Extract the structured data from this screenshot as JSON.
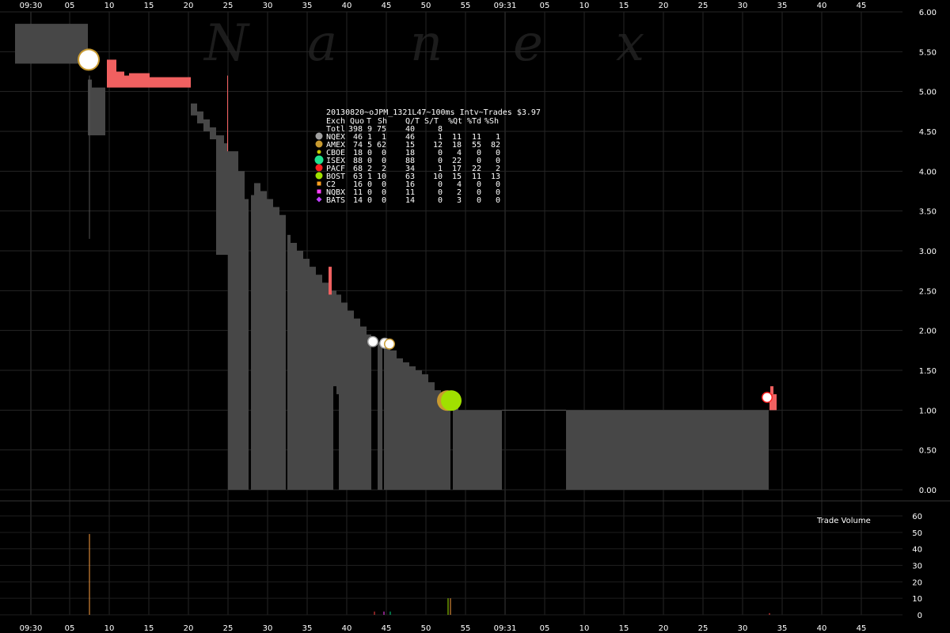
{
  "chart_data": {
    "type": "line",
    "title": "20130820~oJPM_1321L47~100ms Intv~Trades $3.97",
    "watermark": [
      "N",
      "a",
      "n",
      "e",
      "x"
    ],
    "x_axis": {
      "start_label": "09:30",
      "mid_label": "09:31",
      "tick_labels": [
        "09:30",
        "05",
        "10",
        "15",
        "20",
        "25",
        "30",
        "35",
        "40",
        "45",
        "50",
        "55",
        "09:31",
        "05",
        "10",
        "15",
        "20",
        "25",
        "30",
        "35",
        "40",
        "45"
      ],
      "unit": "seconds after 09:30:00",
      "range": [
        -3.5,
        115
      ]
    },
    "price_axis": {
      "tick_labels": [
        "6.00",
        "5.50",
        "5.00",
        "4.50",
        "4.00",
        "3.50",
        "3.00",
        "2.50",
        "2.00",
        "1.50",
        "1.00",
        "0.50",
        "0.00"
      ],
      "range": [
        0,
        6
      ]
    },
    "volume_panel": {
      "label": "Trade Volume",
      "tick_labels": [
        "60",
        "50",
        "40",
        "30",
        "20",
        "10",
        "0"
      ],
      "range": [
        0,
        60
      ],
      "bars": [
        {
          "t": 7.4,
          "v": 49,
          "color": "#ffa040"
        },
        {
          "t": 43.4,
          "v": 2,
          "color": "#ff4040"
        },
        {
          "t": 44.6,
          "v": 2,
          "color": "#ff40ff"
        },
        {
          "t": 45.4,
          "v": 2,
          "color": "#00d080"
        },
        {
          "t": 52.7,
          "v": 10,
          "color": "#a0e000"
        },
        {
          "t": 53.0,
          "v": 10,
          "color": "#ffa040"
        },
        {
          "t": 93.3,
          "v": 1,
          "color": "#ff4040"
        }
      ]
    },
    "nbbo_segments": [
      {
        "t0": -2,
        "t1": 7.2,
        "bid": 5.35,
        "ask": 5.85
      },
      {
        "t0": 7.2,
        "t1": 7.7,
        "bid": 4.45,
        "ask": 5.15
      },
      {
        "t0": 7.7,
        "t1": 8.5,
        "bid": 4.45,
        "ask": 5.05
      },
      {
        "t0": 8.5,
        "t1": 9.4,
        "bid": 4.45,
        "ask": 5.05
      },
      {
        "t0": 20.2,
        "t1": 21,
        "bid": 4.7,
        "ask": 4.85
      },
      {
        "t0": 21,
        "t1": 21.8,
        "bid": 4.6,
        "ask": 4.75
      },
      {
        "t0": 21.8,
        "t1": 22.6,
        "bid": 4.5,
        "ask": 4.65
      },
      {
        "t0": 22.6,
        "t1": 23.4,
        "bid": 4.4,
        "ask": 4.55
      },
      {
        "t0": 23.4,
        "t1": 24.4,
        "bid": 2.95,
        "ask": 4.45
      },
      {
        "t0": 24.4,
        "t1": 24.9,
        "bid": 2.95,
        "ask": 4.35
      },
      {
        "t0": 24.9,
        "t1": 26.2,
        "bid": 0,
        "ask": 4.25
      },
      {
        "t0": 26.2,
        "t1": 27.0,
        "bid": 0,
        "ask": 4.0
      },
      {
        "t0": 27.0,
        "t1": 27.5,
        "bid": 0,
        "ask": 3.65
      },
      {
        "t0": 27.8,
        "t1": 28.2,
        "bid": 0,
        "ask": 3.7
      },
      {
        "t0": 28.2,
        "t1": 29.0,
        "bid": 0,
        "ask": 3.85
      },
      {
        "t0": 29.0,
        "t1": 29.8,
        "bid": 0,
        "ask": 3.75
      },
      {
        "t0": 29.8,
        "t1": 30.6,
        "bid": 0,
        "ask": 3.65
      },
      {
        "t0": 30.6,
        "t1": 31.4,
        "bid": 0,
        "ask": 3.55
      },
      {
        "t0": 31.4,
        "t1": 32.2,
        "bid": 0,
        "ask": 3.45
      },
      {
        "t0": 32.4,
        "t1": 32.8,
        "bid": 0,
        "ask": 3.2
      },
      {
        "t0": 32.8,
        "t1": 33.6,
        "bid": 0,
        "ask": 3.1
      },
      {
        "t0": 33.6,
        "t1": 34.4,
        "bid": 0,
        "ask": 3.0
      },
      {
        "t0": 34.4,
        "t1": 35.2,
        "bid": 0,
        "ask": 2.9
      },
      {
        "t0": 35.2,
        "t1": 36.0,
        "bid": 0,
        "ask": 2.8
      },
      {
        "t0": 36.0,
        "t1": 36.8,
        "bid": 0,
        "ask": 2.7
      },
      {
        "t0": 36.8,
        "t1": 37.6,
        "bid": 0,
        "ask": 2.6
      },
      {
        "t0": 37.6,
        "t1": 38.2,
        "bid": 0,
        "ask": 2.5
      },
      {
        "t0": 38.2,
        "t1": 38.6,
        "bid": 1.3,
        "ask": 2.5
      },
      {
        "t0": 38.6,
        "t1": 38.9,
        "bid": 1.2,
        "ask": 2.45
      },
      {
        "t0": 38.9,
        "t1": 39.2,
        "bid": 0,
        "ask": 2.45
      },
      {
        "t0": 39.2,
        "t1": 40.0,
        "bid": 0,
        "ask": 2.35
      },
      {
        "t0": 40.0,
        "t1": 40.8,
        "bid": 0,
        "ask": 2.25
      },
      {
        "t0": 40.8,
        "t1": 41.6,
        "bid": 0,
        "ask": 2.15
      },
      {
        "t0": 41.6,
        "t1": 42.4,
        "bid": 0,
        "ask": 2.05
      },
      {
        "t0": 42.4,
        "t1": 43.0,
        "bid": 0,
        "ask": 1.95
      },
      {
        "t0": 43.8,
        "t1": 44.4,
        "bid": 0,
        "ask": 1.85
      },
      {
        "t0": 44.6,
        "t1": 45.4,
        "bid": 0,
        "ask": 1.85
      },
      {
        "t0": 45.4,
        "t1": 46.2,
        "bid": 0,
        "ask": 1.75
      },
      {
        "t0": 46.2,
        "t1": 47.0,
        "bid": 0,
        "ask": 1.65
      },
      {
        "t0": 47.0,
        "t1": 47.8,
        "bid": 0,
        "ask": 1.6
      },
      {
        "t0": 47.8,
        "t1": 48.6,
        "bid": 0,
        "ask": 1.55
      },
      {
        "t0": 48.6,
        "t1": 49.4,
        "bid": 0,
        "ask": 1.5
      },
      {
        "t0": 49.4,
        "t1": 50.2,
        "bid": 0,
        "ask": 1.45
      },
      {
        "t0": 50.2,
        "t1": 51.0,
        "bid": 0,
        "ask": 1.35
      },
      {
        "t0": 51.0,
        "t1": 51.8,
        "bid": 0,
        "ask": 1.25
      },
      {
        "t0": 51.8,
        "t1": 52.6,
        "bid": 0,
        "ask": 1.2
      },
      {
        "t0": 52.6,
        "t1": 53.0,
        "bid": 0,
        "ask": 1.15
      },
      {
        "t0": 53.3,
        "t1": 54.0,
        "bid": 0,
        "ask": 1.1
      },
      {
        "t0": 54.0,
        "t1": 59.5,
        "bid": 0,
        "ask": 1.0
      },
      {
        "t0": 67.6,
        "t1": 93.2,
        "bid": 0,
        "ask": 1.0
      }
    ],
    "nbbo_lines": [
      {
        "t0": 59.5,
        "t1": 67.6,
        "price": 1.0
      },
      {
        "t0": 7.4,
        "t1": 7.5,
        "price_low": 3.15,
        "price_high": 5.2
      }
    ],
    "quote_bars": [
      {
        "t0": 9.6,
        "t1": 10.8,
        "bid": 5.05,
        "ask": 5.4
      },
      {
        "t0": 10.8,
        "t1": 11.8,
        "bid": 5.05,
        "ask": 5.25
      },
      {
        "t0": 11.8,
        "t1": 12.4,
        "bid": 5.05,
        "ask": 5.2
      },
      {
        "t0": 12.4,
        "t1": 15.0,
        "bid": 5.05,
        "ask": 5.23
      },
      {
        "t0": 15.0,
        "t1": 20.2,
        "bid": 5.05,
        "ask": 5.18
      },
      {
        "t0": 24.8,
        "t1": 24.9,
        "bid": 4.25,
        "ask": 5.2
      },
      {
        "t0": 37.6,
        "t1": 38.0,
        "bid": 2.45,
        "ask": 2.8
      },
      {
        "t0": 93.3,
        "t1": 94.2,
        "bid": 1.0,
        "ask": 1.2
      },
      {
        "t0": 93.4,
        "t1": 93.8,
        "bid": 1.2,
        "ask": 1.3
      }
    ],
    "trades": [
      {
        "t": 7.3,
        "price": 5.4,
        "exchange": "AMEX",
        "size": "large"
      },
      {
        "t": 43.2,
        "price": 1.86,
        "exchange": "NQEX",
        "size": "small"
      },
      {
        "t": 44.7,
        "price": 1.84,
        "exchange": "NQEX",
        "size": "small"
      },
      {
        "t": 45.3,
        "price": 1.83,
        "exchange": "AMEX",
        "size": "small"
      },
      {
        "t": 52.6,
        "price": 1.12,
        "exchange": "AMEX",
        "size": "medium"
      },
      {
        "t": 53.1,
        "price": 1.12,
        "exchange": "BOST",
        "size": "medium"
      },
      {
        "t": 93.0,
        "price": 1.16,
        "exchange": "PACF",
        "size": "small"
      }
    ],
    "stats_table": {
      "header": [
        "Exch",
        "Quo",
        "T",
        "Sh",
        "Q/T",
        "S/T",
        "%Qt",
        "%Td",
        "%Sh"
      ],
      "total": [
        "Totl",
        "398",
        "9",
        "75",
        "40",
        "8",
        "",
        "",
        ""
      ],
      "rows": [
        {
          "exch": "NQEX",
          "quo": "46",
          "t": "1",
          "sh": "1",
          "qt": "46",
          "st": "1",
          "pq": "11",
          "pt": "11",
          "ps": "1",
          "color": "#a0a0a0",
          "marker": "circle"
        },
        {
          "exch": "AMEX",
          "quo": "74",
          "t": "5",
          "sh": "62",
          "qt": "15",
          "st": "12",
          "pq": "18",
          "pt": "55",
          "ps": "82",
          "color": "#c89a30",
          "marker": "circle"
        },
        {
          "exch": "CBOE",
          "quo": "18",
          "t": "0",
          "sh": "0",
          "qt": "18",
          "st": "0",
          "pq": "4",
          "pt": "0",
          "ps": "0",
          "color": "#c8c800",
          "marker": "circle-small"
        },
        {
          "exch": "ISEX",
          "quo": "88",
          "t": "0",
          "sh": "0",
          "qt": "88",
          "st": "0",
          "pq": "22",
          "pt": "0",
          "ps": "0",
          "color": "#20e090",
          "marker": "circle-large"
        },
        {
          "exch": "PACF",
          "quo": "68",
          "t": "2",
          "sh": "2",
          "qt": "34",
          "st": "1",
          "pq": "17",
          "pt": "22",
          "ps": "2",
          "color": "#ff2020",
          "marker": "circle"
        },
        {
          "exch": "BOST",
          "quo": "63",
          "t": "1",
          "sh": "10",
          "qt": "63",
          "st": "10",
          "pq": "15",
          "pt": "11",
          "ps": "13",
          "color": "#a0e000",
          "marker": "circle"
        },
        {
          "exch": "C2",
          "quo": "16",
          "t": "0",
          "sh": "0",
          "qt": "16",
          "st": "0",
          "pq": "4",
          "pt": "0",
          "ps": "0",
          "color": "#ffa020",
          "marker": "square"
        },
        {
          "exch": "NQBX",
          "quo": "11",
          "t": "0",
          "sh": "0",
          "qt": "11",
          "st": "0",
          "pq": "2",
          "pt": "0",
          "ps": "0",
          "color": "#ff40ff",
          "marker": "square"
        },
        {
          "exch": "BATS",
          "quo": "14",
          "t": "0",
          "sh": "0",
          "qt": "14",
          "st": "0",
          "pq": "3",
          "pt": "0",
          "ps": "0",
          "color": "#c040ff",
          "marker": "diamond"
        }
      ]
    },
    "colors": {
      "background": "#000000",
      "nbbo_fill": "#474747",
      "quote_bar": "#f06060",
      "grid": "#262626",
      "text": "#ffffff"
    }
  }
}
